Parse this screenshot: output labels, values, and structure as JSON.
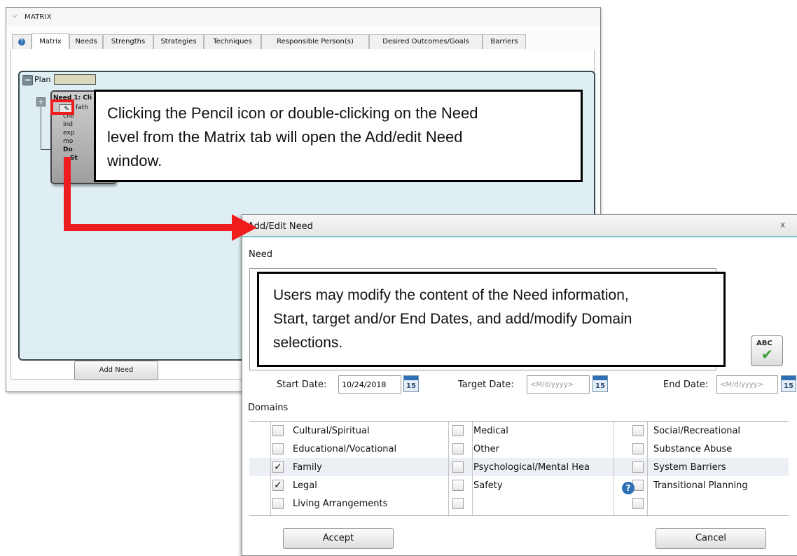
{
  "matrix_panel": {
    "section_title": "MATRIX",
    "tabs": [
      {
        "label": "Matrix"
      },
      {
        "label": "Needs"
      },
      {
        "label": "Strengths"
      },
      {
        "label": "Strategies"
      },
      {
        "label": "Techniques"
      },
      {
        "label": "Responsible Person(s)"
      },
      {
        "label": "Desired Outcomes/Goals"
      },
      {
        "label": "Barriers"
      }
    ],
    "plan_label": "Plan",
    "need_card_lines": [
      "Need 1: Cli",
      "fath",
      "clie",
      "ind",
      "exp",
      "mo",
      "Do",
      "St"
    ],
    "add_need_button": "Add Need"
  },
  "callouts": {
    "callout1": [
      "Clicking the Pencil icon or double-clicking on the Need",
      "level from the Matrix tab will open the Add/edit Need",
      "window."
    ],
    "callout2": [
      "Users may modify the content of the Need information,",
      "Start, target and/or End Dates, and add/modify Domain",
      "selections."
    ]
  },
  "dialog": {
    "title": "Add/Edit Need",
    "close_glyph": "x",
    "need_label": "Need",
    "spellcheck_text": "ABC",
    "start_date_label": "Start Date:",
    "start_date_value": "10/24/2018",
    "target_date_label": "Target Date:",
    "target_date_placeholder": "<M/d/yyyy>",
    "end_date_label": "End Date:",
    "end_date_placeholder": "<M/d/yyyy>",
    "calendar_day": "15",
    "domains_label": "Domains",
    "domains": [
      {
        "label": "Cultural/Spiritual",
        "checked": false
      },
      {
        "label": "Educational/Vocational",
        "checked": false
      },
      {
        "label": "Family",
        "checked": true
      },
      {
        "label": "Legal",
        "checked": true
      },
      {
        "label": "Living Arrangements",
        "checked": false
      },
      {
        "label": "Medical",
        "checked": false
      },
      {
        "label": "Other",
        "checked": false
      },
      {
        "label": "Psychological/Mental Hea",
        "checked": false
      },
      {
        "label": "Safety",
        "checked": false
      },
      {
        "label": "Social/Recreational",
        "checked": false
      },
      {
        "label": "Substance Abuse",
        "checked": false
      },
      {
        "label": "System Barriers",
        "checked": false
      },
      {
        "label": "Transitional Planning",
        "checked": false
      }
    ],
    "check_glyph": "✓",
    "help_glyph": "?",
    "accept_button": "Accept",
    "cancel_button": "Cancel"
  },
  "colors": {
    "callout_arrow": "#ee1c1c",
    "plan_background": "#deeef2",
    "title_accent": "#7cc8d4"
  }
}
